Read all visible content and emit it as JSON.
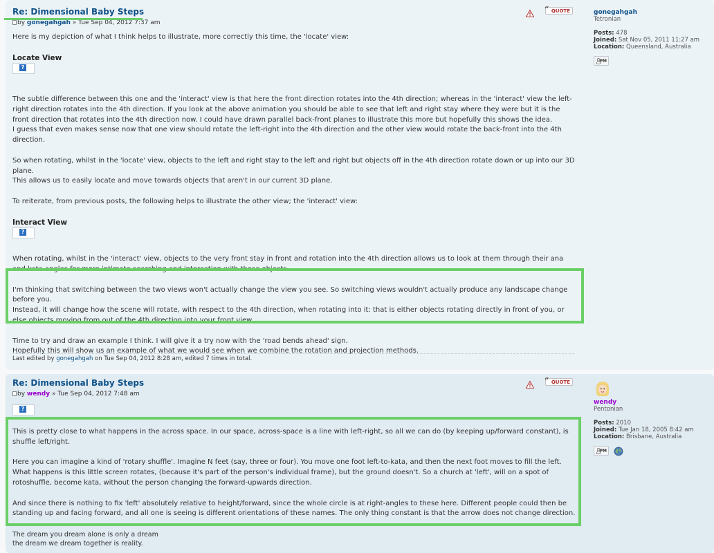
{
  "post1": {
    "title": "Re: Dimensional Baby Steps",
    "author_prefix": "by",
    "author": "gonegahgah",
    "date": "» Tue Sep 04, 2012 7:37 am",
    "quote_label": "QUOTE",
    "intro": "Here is my depiction of what I think helps to illustrate, more correctly this time, the 'locate' view:",
    "locate_heading": "Locate View",
    "p1": "The subtle difference between this one and the 'interact' view is that here the front direction rotates into the 4th direction; whereas in the 'interact' view the left-right direction rotates into the 4th direction. If you look at the above animation you should be able to see that left and right stay where they were but it is the front direction that rotates into the 4th direction now. I could have drawn parallel back-front planes to illustrate this more but hopefully this shows the idea.",
    "p2": "I guess that even makes sense now that one view should rotate the left-right into the 4th direction and the other view would rotate the back-front into the 4th direction.",
    "p3": "So when rotating, whilst in the 'locate' view, objects to the left and right stay to the left and right but objects off in the 4th direction rotate down or up into our 3D plane.",
    "p4": "This allows us to easily locate and move towards objects that aren't in our current 3D plane.",
    "p5": "To reiterate, from previous posts, the following helps to illustrate the other view; the 'interact' view:",
    "interact_heading": "Interact View",
    "p6": "When rotating, whilst in the 'interact' view, objects to the very front stay in front and rotation into the 4th direction allows us to look at them through their ana and kata angles for more intimate searching and interaction with those objects.",
    "p7": "I'm thinking that switching between the two views won't actually change the view you see. So switching views wouldn't actually produce any landscape change before you.",
    "p8": "Instead, it will change how the scene will rotate, with respect to the 4th direction, when rotating into it: that is either objects rotating directly in front of you, or else objects moving from out of the 4th direction into your front view.",
    "p9": "Time to try and draw an example I think. I will give it a try now with the 'road bends ahead' sign.",
    "p10": "Hopefully this will show us an example of what we would see when we combine the rotation and projection methods.",
    "edited_prefix": "Last edited by",
    "edited_user": "gonegahgah",
    "edited_suffix": "on Tue Sep 04, 2012 8:28 am, edited 7 times in total."
  },
  "profile1": {
    "name": "gonegahgah",
    "rank": "Tetronian",
    "posts_label": "Posts:",
    "posts": "478",
    "joined_label": "Joined:",
    "joined": "Sat Nov 05, 2011 11:27 am",
    "location_label": "Location:",
    "location": "Queensland, Australia",
    "pm_label": "PM"
  },
  "post2": {
    "title": "Re: Dimensional Baby Steps",
    "author_prefix": "by",
    "author": "wendy",
    "date": "» Tue Sep 04, 2012 7:48 am",
    "quote_label": "QUOTE",
    "p1": "This is pretty close to what happens in the across space. In our space, across-space is a line with left-right, so all we can do (by keeping up/forward constant), is shuffle left/right.",
    "p2": "Here you can imagine a kind of 'rotary shuffle'. Imagine N feet (say, three or four). You move one foot left-to-kata, and then the next foot moves to fill the left. What happens is this little screen rotates, (because it's part of the person's individual frame), but the ground doesn't. So a church at 'left', will on a spot of rotoshuffle, become kata, without the person changing the forward-upwards direction.",
    "p3": "And since there is nothing to fix 'left' absolutely relative to height/forward, since the whole circle is at right-angles to these here. Different people could then be standing up and facing forward, and all one is seeing is different orientations of these names. The only thing constant is that the arrow does not change direction.",
    "sig1": "The dream you dream alone is only a dream",
    "sig2": "the dream we dream together is reality."
  },
  "profile2": {
    "name": "wendy",
    "rank": "Pentonian",
    "posts_label": "Posts:",
    "posts": "2010",
    "joined_label": "Joined:",
    "joined": "Tue Jan 18, 2005 8:42 am",
    "location_label": "Location:",
    "location": "Brisbane, Australia",
    "pm_label": "PM"
  },
  "colors": {
    "highlight": "#6bcf68",
    "link": "#105289",
    "moderator_name": "#9900cc"
  }
}
